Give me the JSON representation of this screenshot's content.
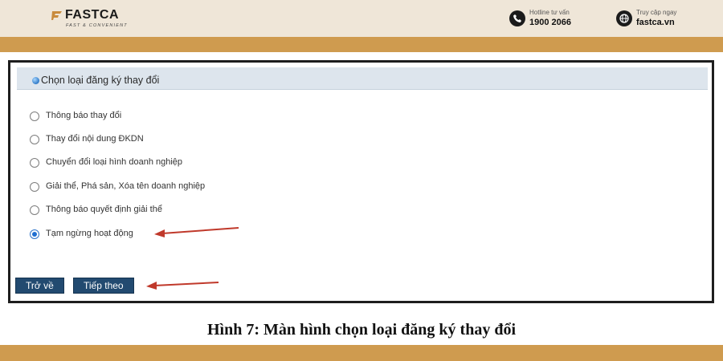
{
  "header": {
    "brand_name": "FASTCA",
    "brand_tagline": "FAST & CONVENIENT",
    "hotline_label": "Hotline tư vấn",
    "hotline_number": "1900 2066",
    "website_label": "Truy cập ngay",
    "website_url": "fastca.vn"
  },
  "panel": {
    "title": "Chọn loại đăng ký thay đổi",
    "options": [
      {
        "label": "Thông báo thay đổi",
        "checked": false
      },
      {
        "label": "Thay đổi nội dung ĐKDN",
        "checked": false
      },
      {
        "label": "Chuyển đổi loại hình doanh nghiệp",
        "checked": false
      },
      {
        "label": "Giải thể, Phá sản, Xóa tên doanh nghiệp",
        "checked": false
      },
      {
        "label": "Thông báo quyết định giải thể",
        "checked": false
      },
      {
        "label": "Tạm ngừng hoạt động",
        "checked": true
      }
    ],
    "back_label": "Trở về",
    "next_label": "Tiếp theo"
  },
  "caption": "Hình 7: Màn hình chọn loại đăng ký thay đổi",
  "colors": {
    "band": "#cf9b4f",
    "topbar": "#efe6d8",
    "button": "#224a70",
    "arrow": "#c0392b",
    "radio_checked": "#1f6fd1"
  }
}
